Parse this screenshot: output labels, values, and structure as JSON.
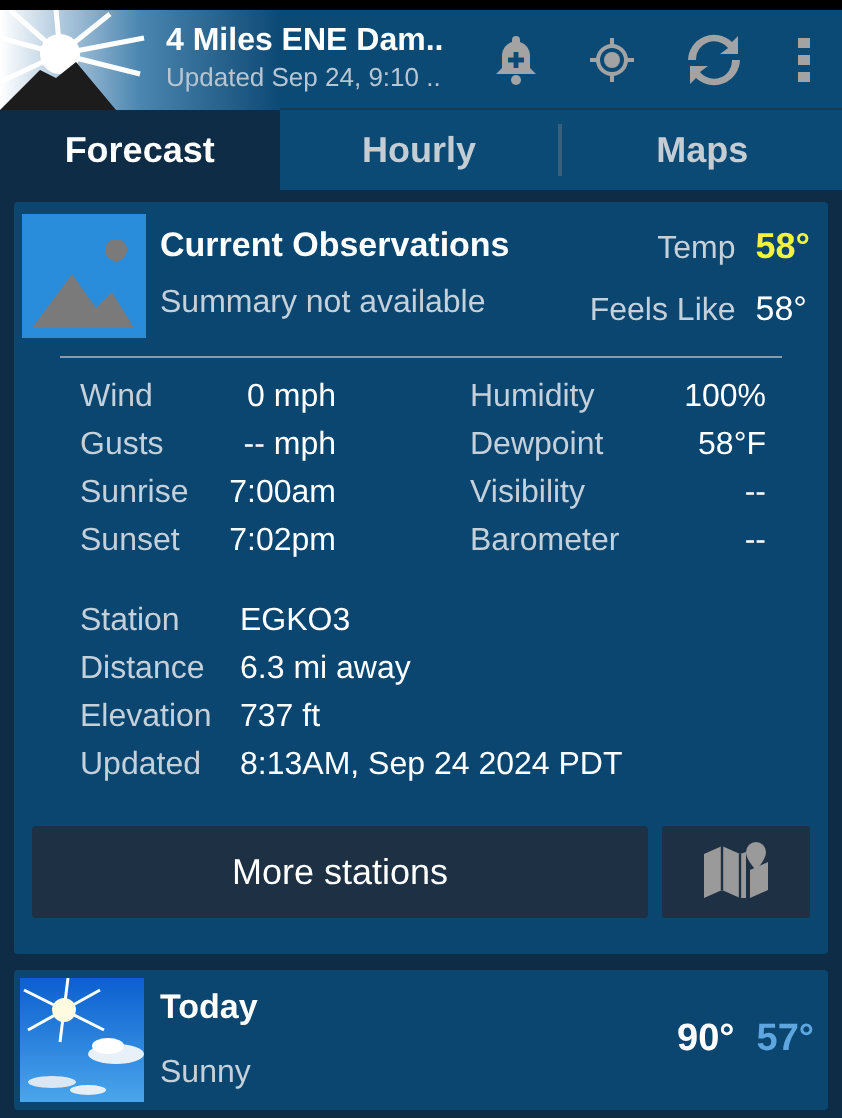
{
  "header": {
    "title": "4 Miles ENE Dam..",
    "subtitle": "Updated Sep 24, 9:10 .."
  },
  "tabs": [
    {
      "label": "Forecast",
      "selected": true
    },
    {
      "label": "Hourly",
      "selected": false
    },
    {
      "label": "Maps",
      "selected": false
    }
  ],
  "observations": {
    "title": "Current Observations",
    "summary": "Summary not available",
    "temp_label": "Temp",
    "temp": "58°",
    "feels_label": "Feels Like",
    "feels": "58°",
    "left_rows": [
      {
        "label": "Wind",
        "value": "0 mph"
      },
      {
        "label": "Gusts",
        "value": "-- mph"
      },
      {
        "label": "Sunrise",
        "value": "7:00am"
      },
      {
        "label": "Sunset",
        "value": "7:02pm"
      }
    ],
    "right_rows": [
      {
        "label": "Humidity",
        "value": "100%"
      },
      {
        "label": "Dewpoint",
        "value": "58°F"
      },
      {
        "label": "Visibility",
        "value": "--"
      },
      {
        "label": "Barometer",
        "value": "--"
      }
    ],
    "station_rows": [
      {
        "label": "Station",
        "value": "EGKO3"
      },
      {
        "label": "Distance",
        "value": "6.3 mi away"
      },
      {
        "label": "Elevation",
        "value": "737 ft"
      },
      {
        "label": "Updated",
        "value": "8:13AM, Sep 24 2024 PDT"
      }
    ],
    "button": "More stations"
  },
  "today": {
    "day": "Today",
    "condition": "Sunny",
    "high": "90°",
    "low": "57°"
  }
}
